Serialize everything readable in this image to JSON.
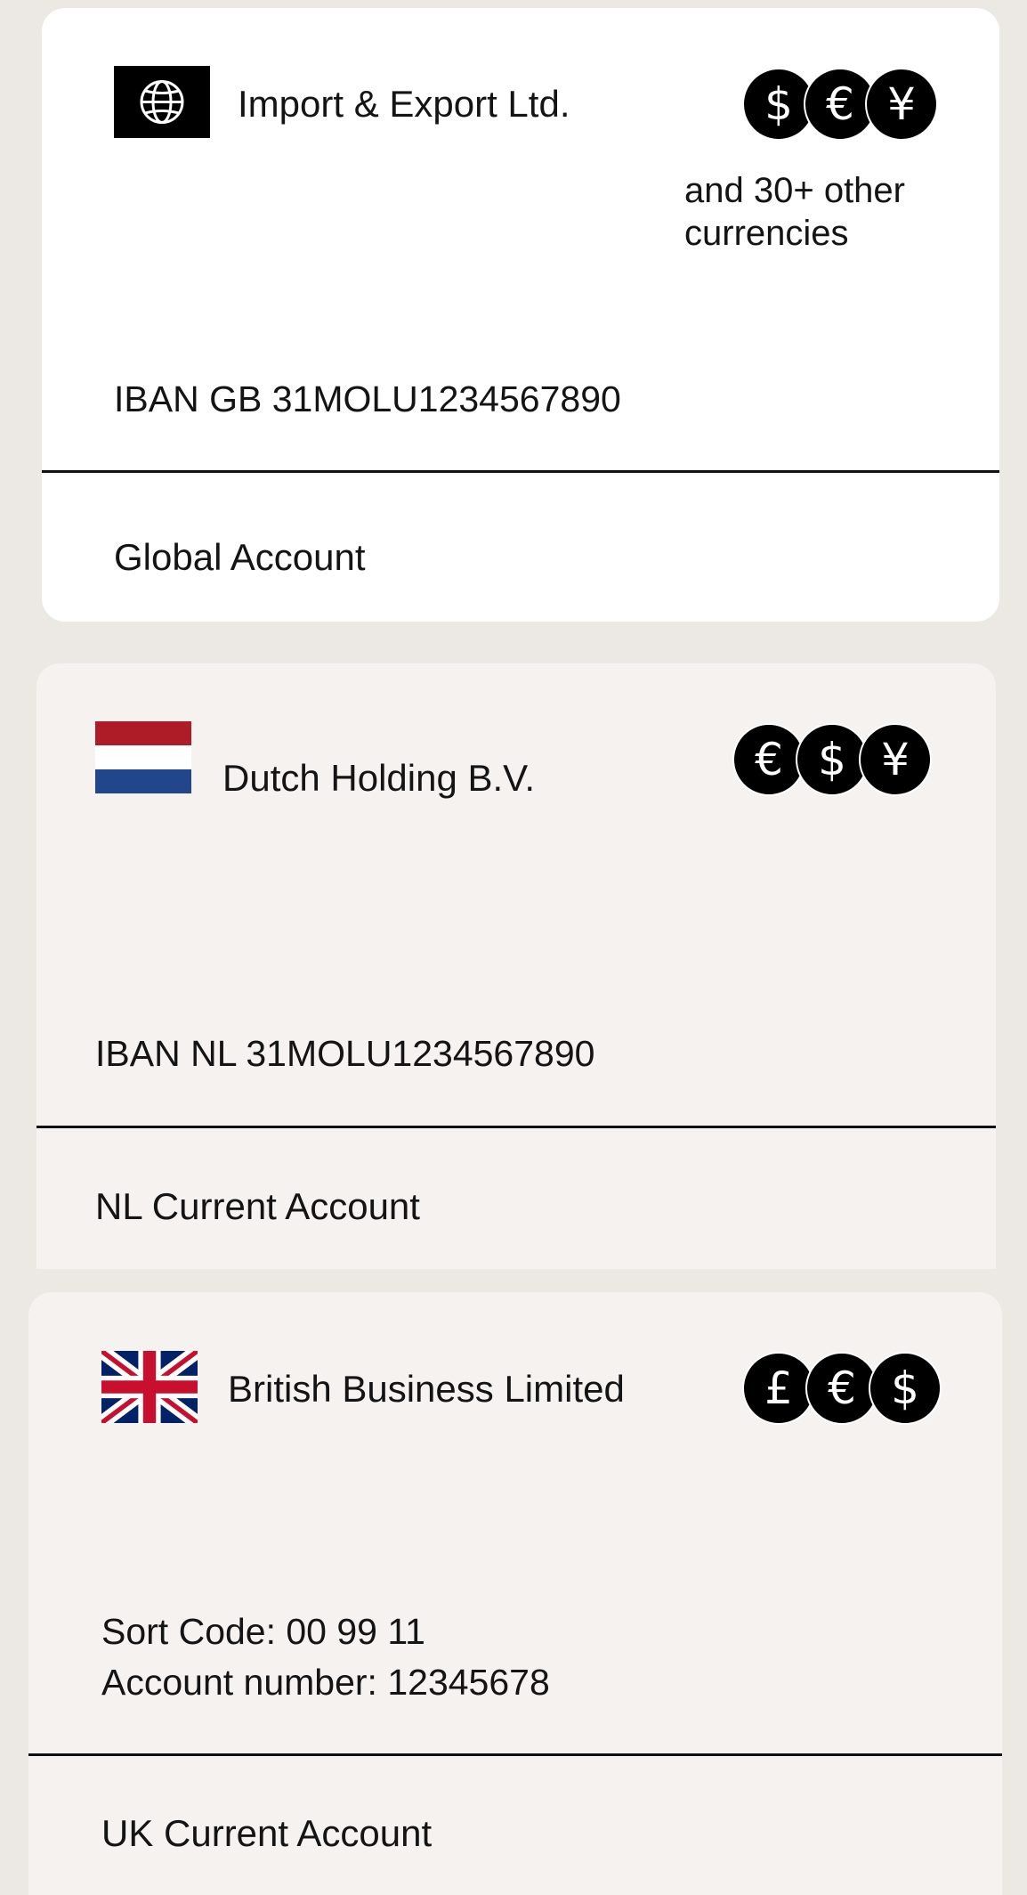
{
  "accounts": [
    {
      "company": "Import & Export Ltd.",
      "icon": "globe-icon",
      "currencies": [
        "$",
        "€",
        "¥"
      ],
      "currency_note_line1": "and 30+ other",
      "currency_note_line2": "currencies",
      "detail_line1": "IBAN GB 31MOLU1234567890",
      "account_type": "Global Account"
    },
    {
      "company": "Dutch Holding B.V.",
      "icon": "netherlands-flag-icon",
      "currencies": [
        "€",
        "$",
        "¥"
      ],
      "detail_line1": "IBAN NL 31MOLU1234567890",
      "account_type": "NL Current Account"
    },
    {
      "company": "British Business Limited",
      "icon": "uk-flag-icon",
      "currencies": [
        "£",
        "€",
        "$"
      ],
      "detail_line1": "Sort Code: 00 99 11",
      "detail_line2": "Account number: 12345678",
      "account_type": "UK Current Account"
    }
  ],
  "colors": {
    "page_background": "#ECE8E3",
    "active_card": "#FFFFFF",
    "inactive_card": "#F5F2EF",
    "coin": "#000000",
    "nl_red": "#AE1C28",
    "nl_blue": "#21468B",
    "uk_blue": "#012169",
    "uk_red": "#C8102E"
  }
}
